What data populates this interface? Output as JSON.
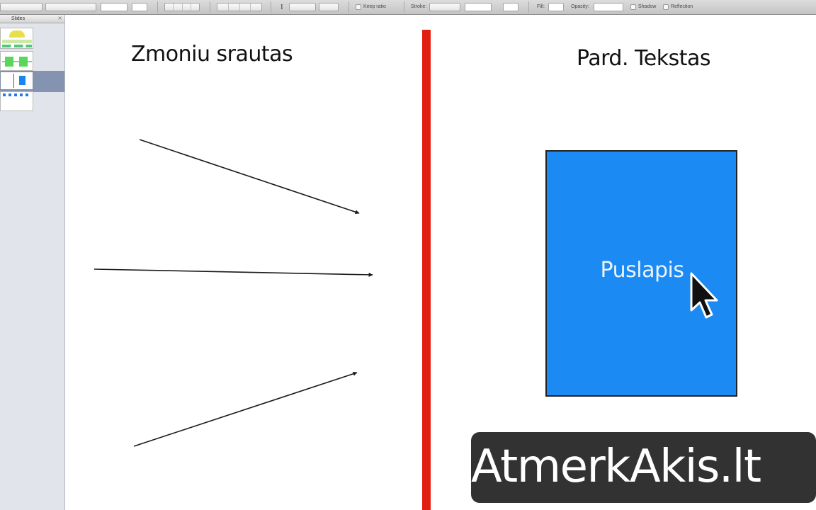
{
  "toolbar": {
    "keep_ratio_label": "Keep ratio",
    "stroke_label": "Stroke:",
    "fill_label": "Fill:",
    "opacity_label": "Opacity:",
    "shadow_label": "Shadow",
    "reflection_label": "Reflection"
  },
  "navigator": {
    "title": "Slides",
    "selected_slide": 3,
    "slide_count": 4
  },
  "slide": {
    "left_title": "Zmoniu srautas",
    "right_title": "Pard. Tekstas",
    "box_label": "Puslapis"
  },
  "watermark": {
    "text": "AtmerkAkis.lt"
  },
  "colors": {
    "divider": "#e01e12",
    "box_fill": "#1b8af2",
    "box_label": "#eaf4ff",
    "watermark_bg": "#323232",
    "arrow": "#1a1a1a"
  },
  "icons": [
    "text-ibeam-icon",
    "close-icon",
    "mouse-pointer-icon"
  ]
}
